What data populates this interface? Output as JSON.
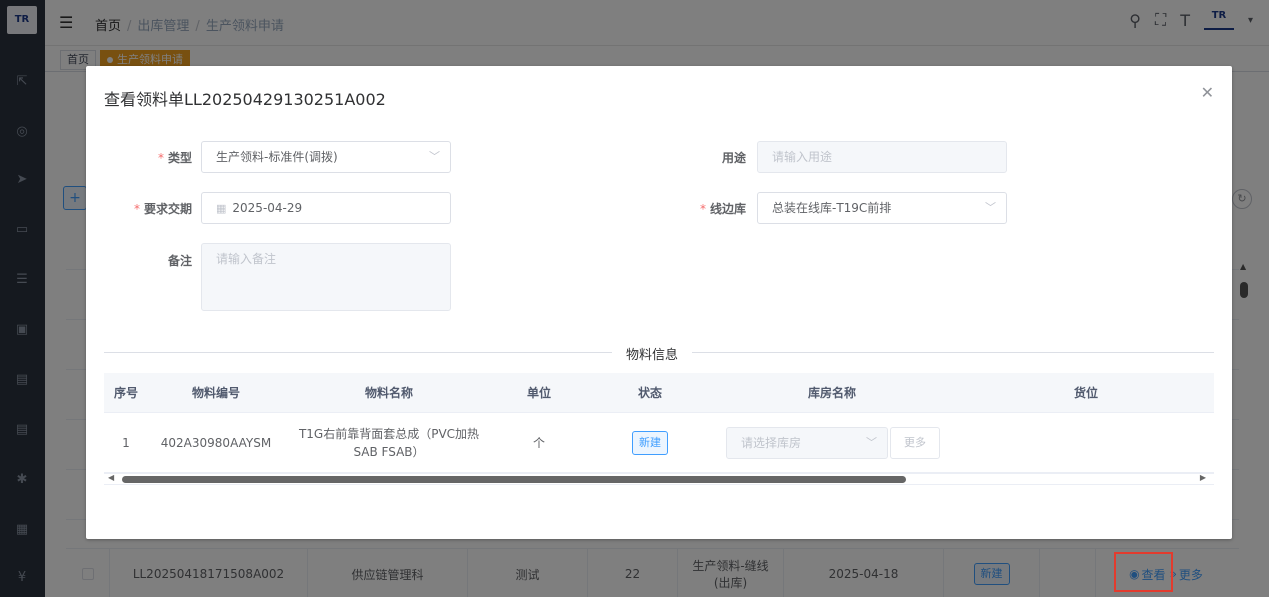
{
  "sidebar": {
    "logo": "TR",
    "icons": [
      "external-link-icon",
      "dashboard-icon",
      "send-icon",
      "monitor-icon",
      "list-icon",
      "screen-icon",
      "chart-icon",
      "report-icon",
      "bug-icon",
      "table-icon",
      "yen-icon"
    ]
  },
  "header": {
    "breadcrumb": [
      "首页",
      "出库管理",
      "生产领料申请"
    ],
    "brand": "TR"
  },
  "tags": [
    {
      "label": "首页"
    },
    {
      "label": "生产领料申请"
    }
  ],
  "dialog": {
    "title": "查看领料单LL20250429130251A002",
    "type": {
      "label": "类型",
      "value": "生产领料-标准件(调拨)"
    },
    "purpose": {
      "label": "用途",
      "placeholder": "请输入用途"
    },
    "due_date": {
      "label": "要求交期",
      "value": "2025-04-29"
    },
    "line_store": {
      "label": "线边库",
      "value": "总装在线库-T19C前排"
    },
    "remark": {
      "label": "备注",
      "placeholder": "请输入备注"
    },
    "section_title": "物料信息",
    "table": {
      "headers": [
        "序号",
        "物料编号",
        "物料名称",
        "单位",
        "状态",
        "库房名称",
        "货位"
      ],
      "rows": [
        {
          "index": "1",
          "code": "402A30980AAYSM",
          "name": "T1G右前靠背面套总成（PVC加热SAB FSAB）",
          "unit": "个",
          "status": "新建",
          "store_placeholder": "请选择库房",
          "more": "更多"
        }
      ]
    }
  },
  "background_row": {
    "code": "LL20250418171508A002",
    "dept": "供应链管理科",
    "purpose": "测试",
    "qty": "22",
    "type": "生产领料-缝线(出库)",
    "date": "2025-04-18",
    "status": "新建",
    "view": "查看",
    "more": "更多"
  },
  "colors": {
    "accent": "#409eff",
    "active_tag": "#f0a020",
    "sidebar": "#2b333e",
    "required": "#f56c6c",
    "highlight": "#e33b2e"
  }
}
